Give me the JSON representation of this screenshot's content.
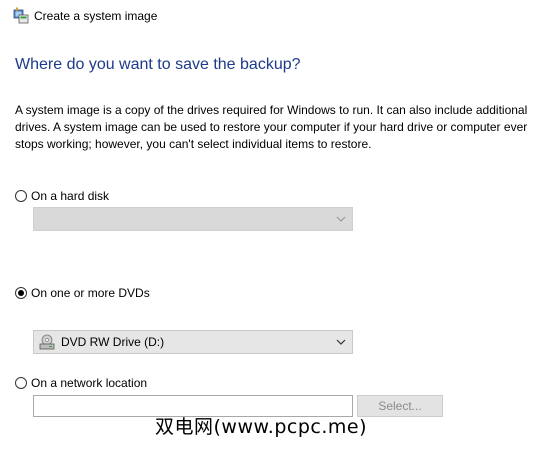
{
  "window": {
    "title": "Create a system image",
    "icon": "system-image-icon"
  },
  "heading": "Where do you want to save the backup?",
  "description": "A system image is a copy of the drives required for Windows to run. It can also include additional drives. A system image can be used to restore your computer if your hard drive or computer ever stops working; however, you can't select individual items to restore.",
  "options": {
    "hard_disk": {
      "label": "On a hard disk",
      "selected": false,
      "select_value": "",
      "disabled": true
    },
    "dvds": {
      "label": "On one or more DVDs",
      "selected": true,
      "select_value": "DVD RW Drive (D:)",
      "drive_icon": "dvd-drive-icon"
    },
    "network": {
      "label": "On a network location",
      "selected": false,
      "input_value": "",
      "button_label": "Select..."
    }
  },
  "watermark": "双电网(www.pcpc.me)",
  "colors": {
    "heading": "#1e3a8a",
    "disabled_select": "#d9d9d9",
    "enabled_select": "#e6e6e6",
    "button_text_disabled": "#8a8a8a"
  }
}
